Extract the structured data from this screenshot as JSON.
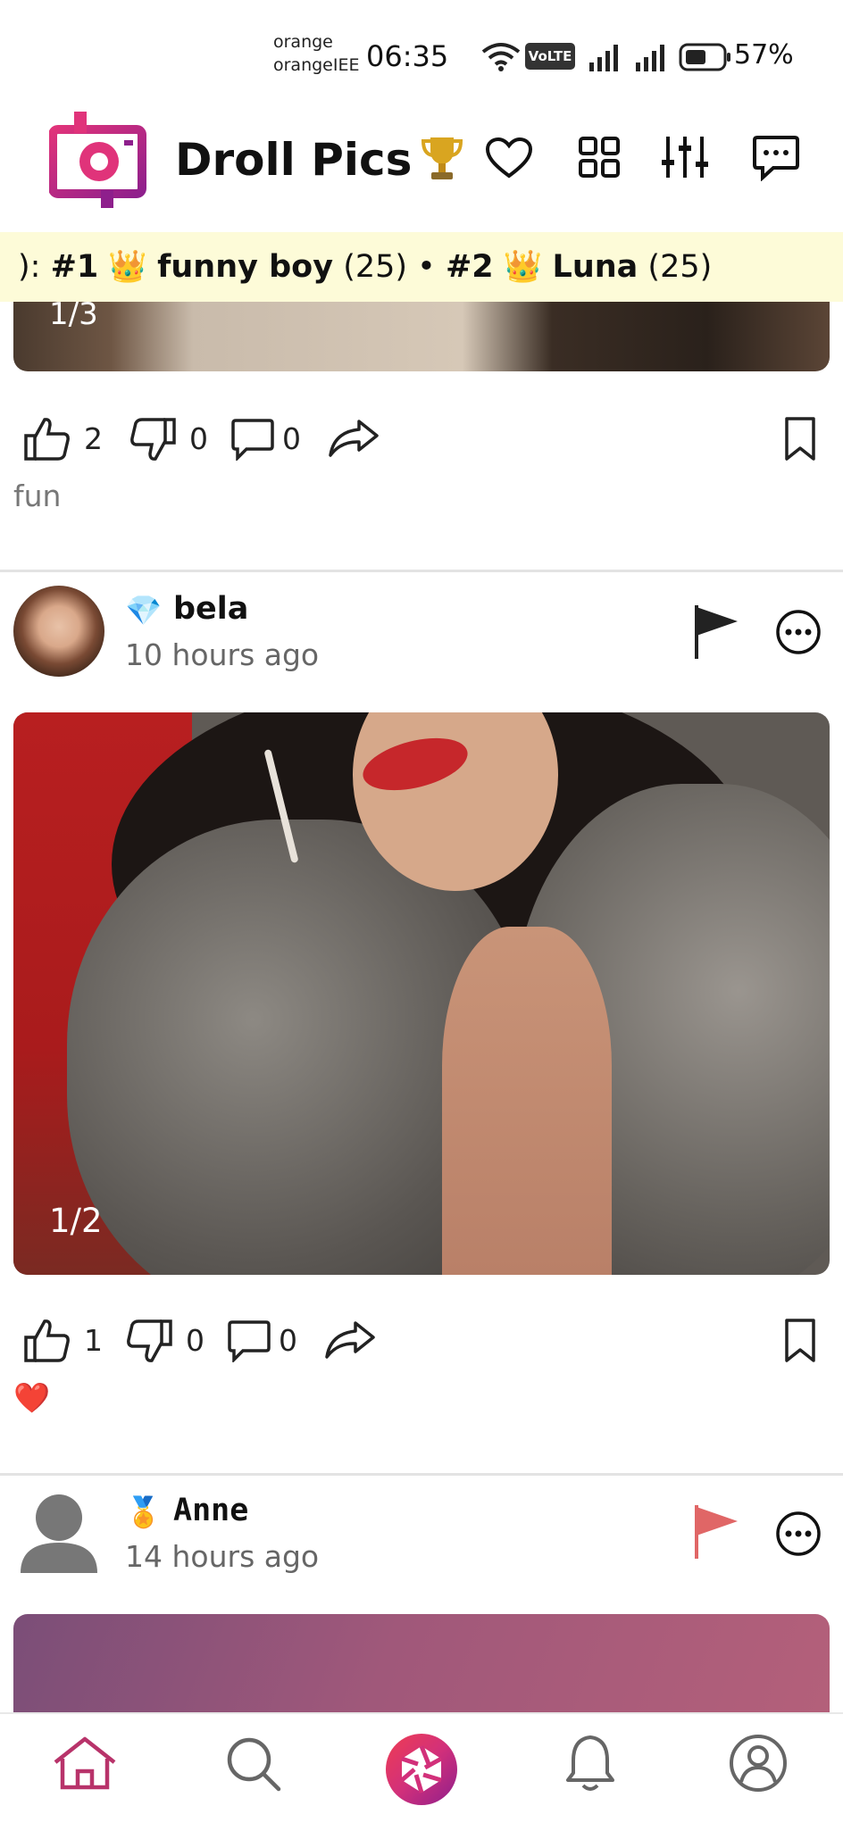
{
  "status_bar": {
    "carrier_line1": "orange",
    "carrier_line2": "orangeIEE",
    "time": "06:35",
    "volte": "VoLTE",
    "battery": "57%"
  },
  "header": {
    "title": "Droll Pics",
    "icons": [
      "app-logo-icon",
      "trophy-icon",
      "heart-icon",
      "grid-icon",
      "filter-sliders-icon",
      "chat-icon"
    ]
  },
  "leaderboard": {
    "prefix": "): ",
    "rank1": "#1",
    "name1": "funny boy",
    "score1": "(25)",
    "separator": " • ",
    "rank2": "#2",
    "name2": "Luna",
    "score2": "(25)",
    "crown": "👑"
  },
  "posts": [
    {
      "image_counter": "1/3",
      "likes": "2",
      "dislikes": "0",
      "comments": "0",
      "caption": "fun"
    },
    {
      "badge": "💎",
      "username": "bela",
      "time": "10 hours ago",
      "image_counter": "1/2",
      "likes": "1",
      "dislikes": "0",
      "comments": "0",
      "caption": "❤️",
      "flag_color": "#222222"
    },
    {
      "badge": "🏅",
      "username": "Anne",
      "time": "14 hours ago",
      "flag_color": "#e06666"
    }
  ],
  "bottom_nav": {
    "items": [
      "home-icon",
      "search-icon",
      "camera-shutter-icon",
      "bell-icon",
      "profile-icon"
    ],
    "active_color": "#b8336a"
  },
  "colors": {
    "brand_pink": "#e0337a",
    "brand_purple": "#8e1f8c",
    "banner_bg": "#fdfbd8"
  }
}
